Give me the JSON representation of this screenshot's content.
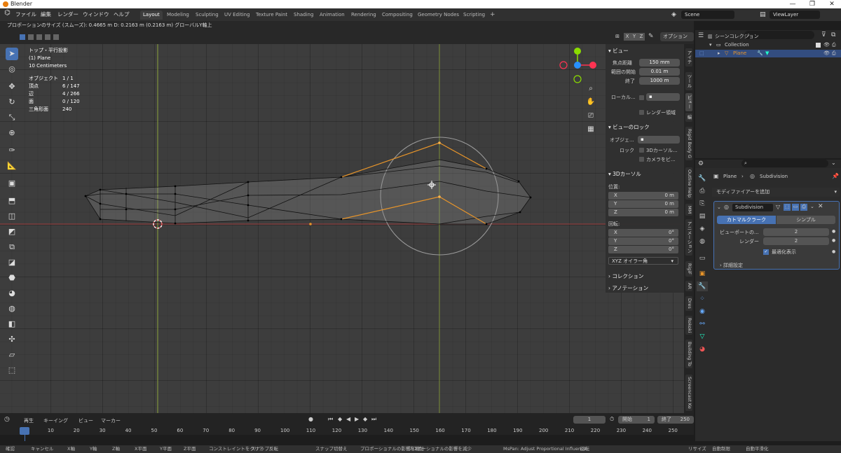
{
  "window": {
    "title": "Blender"
  },
  "menus": [
    "ファイル",
    "編集",
    "レンダー",
    "ウィンドウ",
    "ヘルプ"
  ],
  "workspaces": [
    "Layout",
    "Modeling",
    "Sculpting",
    "UV Editing",
    "Texture Paint",
    "Shading",
    "Animation",
    "Rendering",
    "Compositing",
    "Geometry Nodes",
    "Scripting"
  ],
  "active_workspace": "Layout",
  "add_tab": "+",
  "scene": "Scene",
  "view_layer": "ViewLayer",
  "status_line": "プロポーションのサイズ (スムーズ): 0.4665 m   D: 0.2163 m (0.2163 m) グローバルY軸上",
  "viewport": {
    "view_name": "トップ・平行投影",
    "object_name": "(1) Plane",
    "scale": "10 Centimeters",
    "stats": [
      [
        "オブジェクト",
        "1 / 1"
      ],
      [
        "頂点",
        "6 / 147"
      ],
      [
        "辺",
        "4 / 266"
      ],
      [
        "面",
        "0 / 120"
      ],
      [
        "三角形面",
        "240"
      ]
    ],
    "axes": [
      "X",
      "Y",
      "Z"
    ],
    "options_label": "オプション"
  },
  "npanel": {
    "view_title": "ビュー",
    "focal_label": "焦点距離",
    "focal": "150 mm",
    "clip_start_label": "範囲の開始",
    "clip_start": "0.01 m",
    "clip_end_label": "終了",
    "clip_end": "1000 m",
    "local_label": "ローカル...",
    "render_region": "レンダー領域",
    "view_lock_title": "ビューのロック",
    "lock_object_label": "オブジェ...",
    "lock_label": "ロック",
    "lock_3dcursor": "3Dカーソル...",
    "lock_camera": "カメラをビ...",
    "cursor_title": "3Dカーソル",
    "location_label": "位置:",
    "loc": [
      [
        "X",
        "0 m"
      ],
      [
        "Y",
        "0 m"
      ],
      [
        "Z",
        "0 m"
      ]
    ],
    "rotation_label": "回転:",
    "rot": [
      [
        "X",
        "0°"
      ],
      [
        "Y",
        "0°"
      ],
      [
        "Z",
        "0°"
      ]
    ],
    "rot_mode": "XYZ オイラー角",
    "collection_title": "コレクション",
    "annotation_title": "アノテーション"
  },
  "side_tabs": [
    "アイテ",
    "ツール",
    "ビュー",
    "編",
    "Rigid Body G",
    "Outline Help",
    "MM",
    "アニメーション",
    "RigiF",
    "AR",
    "Dres",
    "Rokoki",
    "Building To",
    "Screencast Ke"
  ],
  "outliner": {
    "scene_collection": "シーンコレクション",
    "collection": "Collection",
    "plane": "Plane"
  },
  "properties": {
    "breadcrumb_obj": "Plane",
    "breadcrumb_mod": "Subdivision",
    "add_modifier": "モディファイアーを追加",
    "modifier_name": "Subdivision",
    "btn_catmull": "カトマルクラーク",
    "btn_simple": "シンプル",
    "viewport_label": "ビューポートの...",
    "viewport_val": "2",
    "render_label": "レンダー",
    "render_val": "2",
    "optimal_label": "最適化表示",
    "advanced_label": "詳細設定"
  },
  "timeline": {
    "menus": [
      "再生",
      "キーイング",
      "ビュー",
      "マーカー"
    ],
    "current_frame": "1",
    "start_label": "開始",
    "start": "1",
    "end_label": "終了",
    "end": "250",
    "frames": [
      "1",
      "10",
      "20",
      "30",
      "40",
      "50",
      "60",
      "70",
      "80",
      "90",
      "100",
      "110",
      "120",
      "130",
      "140",
      "150",
      "160",
      "170",
      "180",
      "190",
      "200",
      "210",
      "220",
      "230",
      "240",
      "250"
    ]
  },
  "footer": [
    "確認",
    "キャンセル",
    "X軸",
    "Y軸",
    "Z軸",
    "X平面",
    "Y平面",
    "Z平面",
    "コンストレイントをクリア",
    "スナップ反転",
    "スナップ切替え",
    "プロポーショナルの影響を増加",
    "プロポーショナルの影響を減少",
    "MsPan: Adjust Proportional Influence",
    "回転",
    "リサイズ",
    "自動制限",
    "自動平滑化"
  ],
  "colors": {
    "accent": "#4772b3",
    "edit_orange": "#e8952a",
    "x_axis": "#9c3b3b",
    "y_axis": "#8ca43a",
    "gizmo_x": "#ff3352",
    "gizmo_y": "#8bdc00",
    "gizmo_z": "#2890ff"
  }
}
